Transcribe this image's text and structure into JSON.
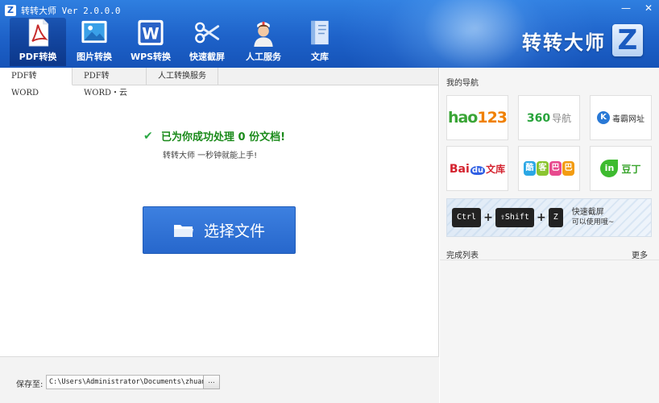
{
  "window": {
    "title": "转转大师 Ver 2.0.0.0",
    "mini_logo": "Z",
    "controls": [
      {
        "name": "minimize-icon",
        "glyph": "—"
      },
      {
        "name": "close-icon",
        "glyph": "✕"
      }
    ]
  },
  "toolbar": {
    "items": [
      {
        "label": "PDF转换",
        "icon": "pdf-icon",
        "active": true
      },
      {
        "label": "图片转换",
        "icon": "image-icon"
      },
      {
        "label": "WPS转换",
        "icon": "wps-icon"
      },
      {
        "label": "快速截屏",
        "icon": "scissors-icon"
      },
      {
        "label": "人工服务",
        "icon": "nurse-icon"
      },
      {
        "label": "文库",
        "icon": "book-icon"
      }
    ]
  },
  "brand": {
    "text": "转转大师",
    "logo": "Z"
  },
  "tabs": [
    "PDF转WORD",
    "PDF转WORD・云",
    "人工转换服务"
  ],
  "main": {
    "success_message": "已为你成功处理 0 份文档!",
    "success_sub": "转转大师 一秒钟就能上手!",
    "select_button": "选择文件"
  },
  "save": {
    "label": "保存至:",
    "path": "C:\\Users\\Administrator\\Documents\\zhuan",
    "browse": "..."
  },
  "nav": {
    "title": "我的导航",
    "hao123": {
      "a": "hao",
      "b": "123"
    },
    "n360": {
      "a": "360",
      "b": "导航"
    },
    "kuba": {
      "k": "K",
      "t": "毒霸网址"
    },
    "baidu": {
      "a": "Bai",
      "b": "du",
      "c": "文库"
    },
    "baba": [
      "酷",
      "客",
      "巴",
      "巴"
    ],
    "baba_colors": [
      "#2ba7e5",
      "#8bc531",
      "#e84a8e",
      "#f39c12"
    ],
    "douding": {
      "a": "in",
      "b": "豆丁"
    }
  },
  "banner": {
    "keys": [
      "Ctrl",
      "⇧Shift",
      "Z"
    ],
    "plus": "+",
    "cap1": "快速截屏",
    "cap2": "可以使用哦~"
  },
  "done": {
    "title": "完成列表",
    "more": "更多"
  },
  "colors": {
    "header": "#1e62c9",
    "accent_button": "#2f72d6",
    "success": "#1a8a1a"
  }
}
